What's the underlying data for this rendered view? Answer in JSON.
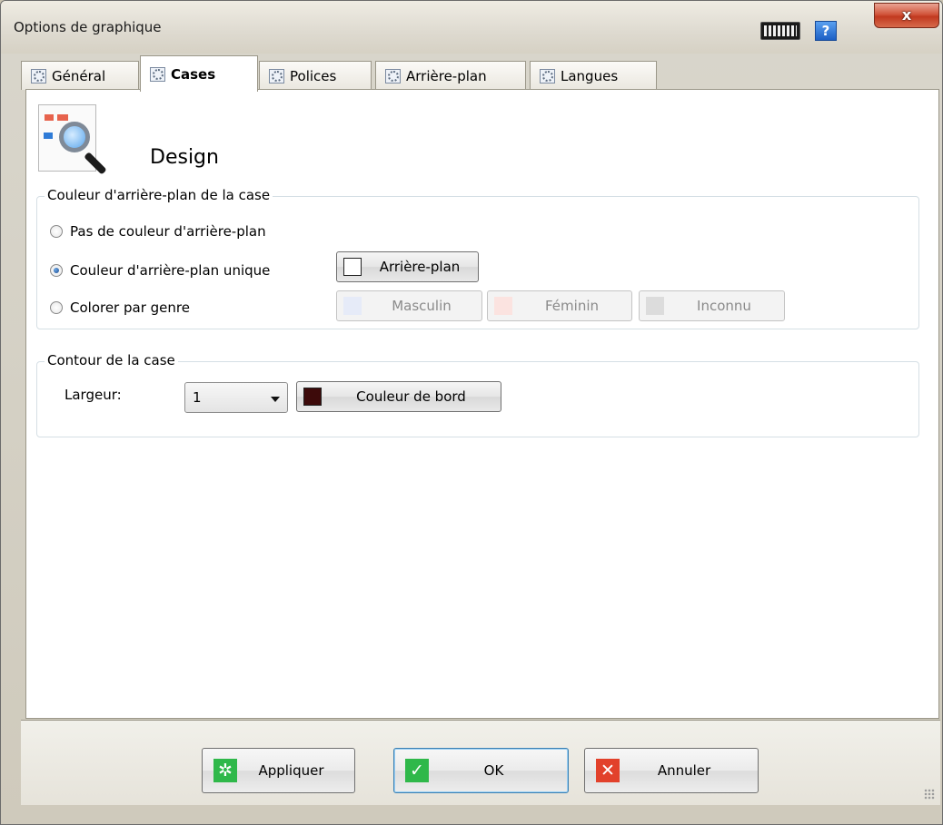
{
  "window": {
    "title": "Options de graphique",
    "close_label": "x",
    "help_label": "?"
  },
  "tabs": [
    {
      "label": "Général",
      "active": false
    },
    {
      "label": "Cases",
      "active": true
    },
    {
      "label": "Polices",
      "active": false
    },
    {
      "label": "Arrière-plan",
      "active": false
    },
    {
      "label": "Langues",
      "active": false
    }
  ],
  "section": {
    "title": "Design"
  },
  "background_group": {
    "legend": "Couleur d'arrière-plan de la case",
    "options": [
      {
        "label": "Pas de couleur d'arrière-plan",
        "checked": false
      },
      {
        "label": "Couleur d'arrière-plan unique",
        "checked": true
      },
      {
        "label": "Colorer par genre",
        "checked": false
      }
    ],
    "background_button": {
      "label": "Arrière-plan",
      "color": "#ffffff"
    },
    "gender_buttons": [
      {
        "label": "Masculin",
        "color": "#e6ebf8"
      },
      {
        "label": "Féminin",
        "color": "#fbe3e0"
      },
      {
        "label": "Inconnu",
        "color": "#dcdcdc"
      }
    ]
  },
  "outline_group": {
    "legend": "Contour de la case",
    "width_label": "Largeur:",
    "width_value": "1",
    "border_button": {
      "label": "Couleur de bord",
      "color": "#3d0a0a"
    }
  },
  "actions": {
    "apply": {
      "label": "Appliquer",
      "icon": "apply-icon",
      "color": "#2fb84a"
    },
    "ok": {
      "label": "OK",
      "icon": "check-icon",
      "color": "#2fb84a"
    },
    "cancel": {
      "label": "Annuler",
      "icon": "cancel-icon",
      "color": "#e2412b"
    }
  }
}
